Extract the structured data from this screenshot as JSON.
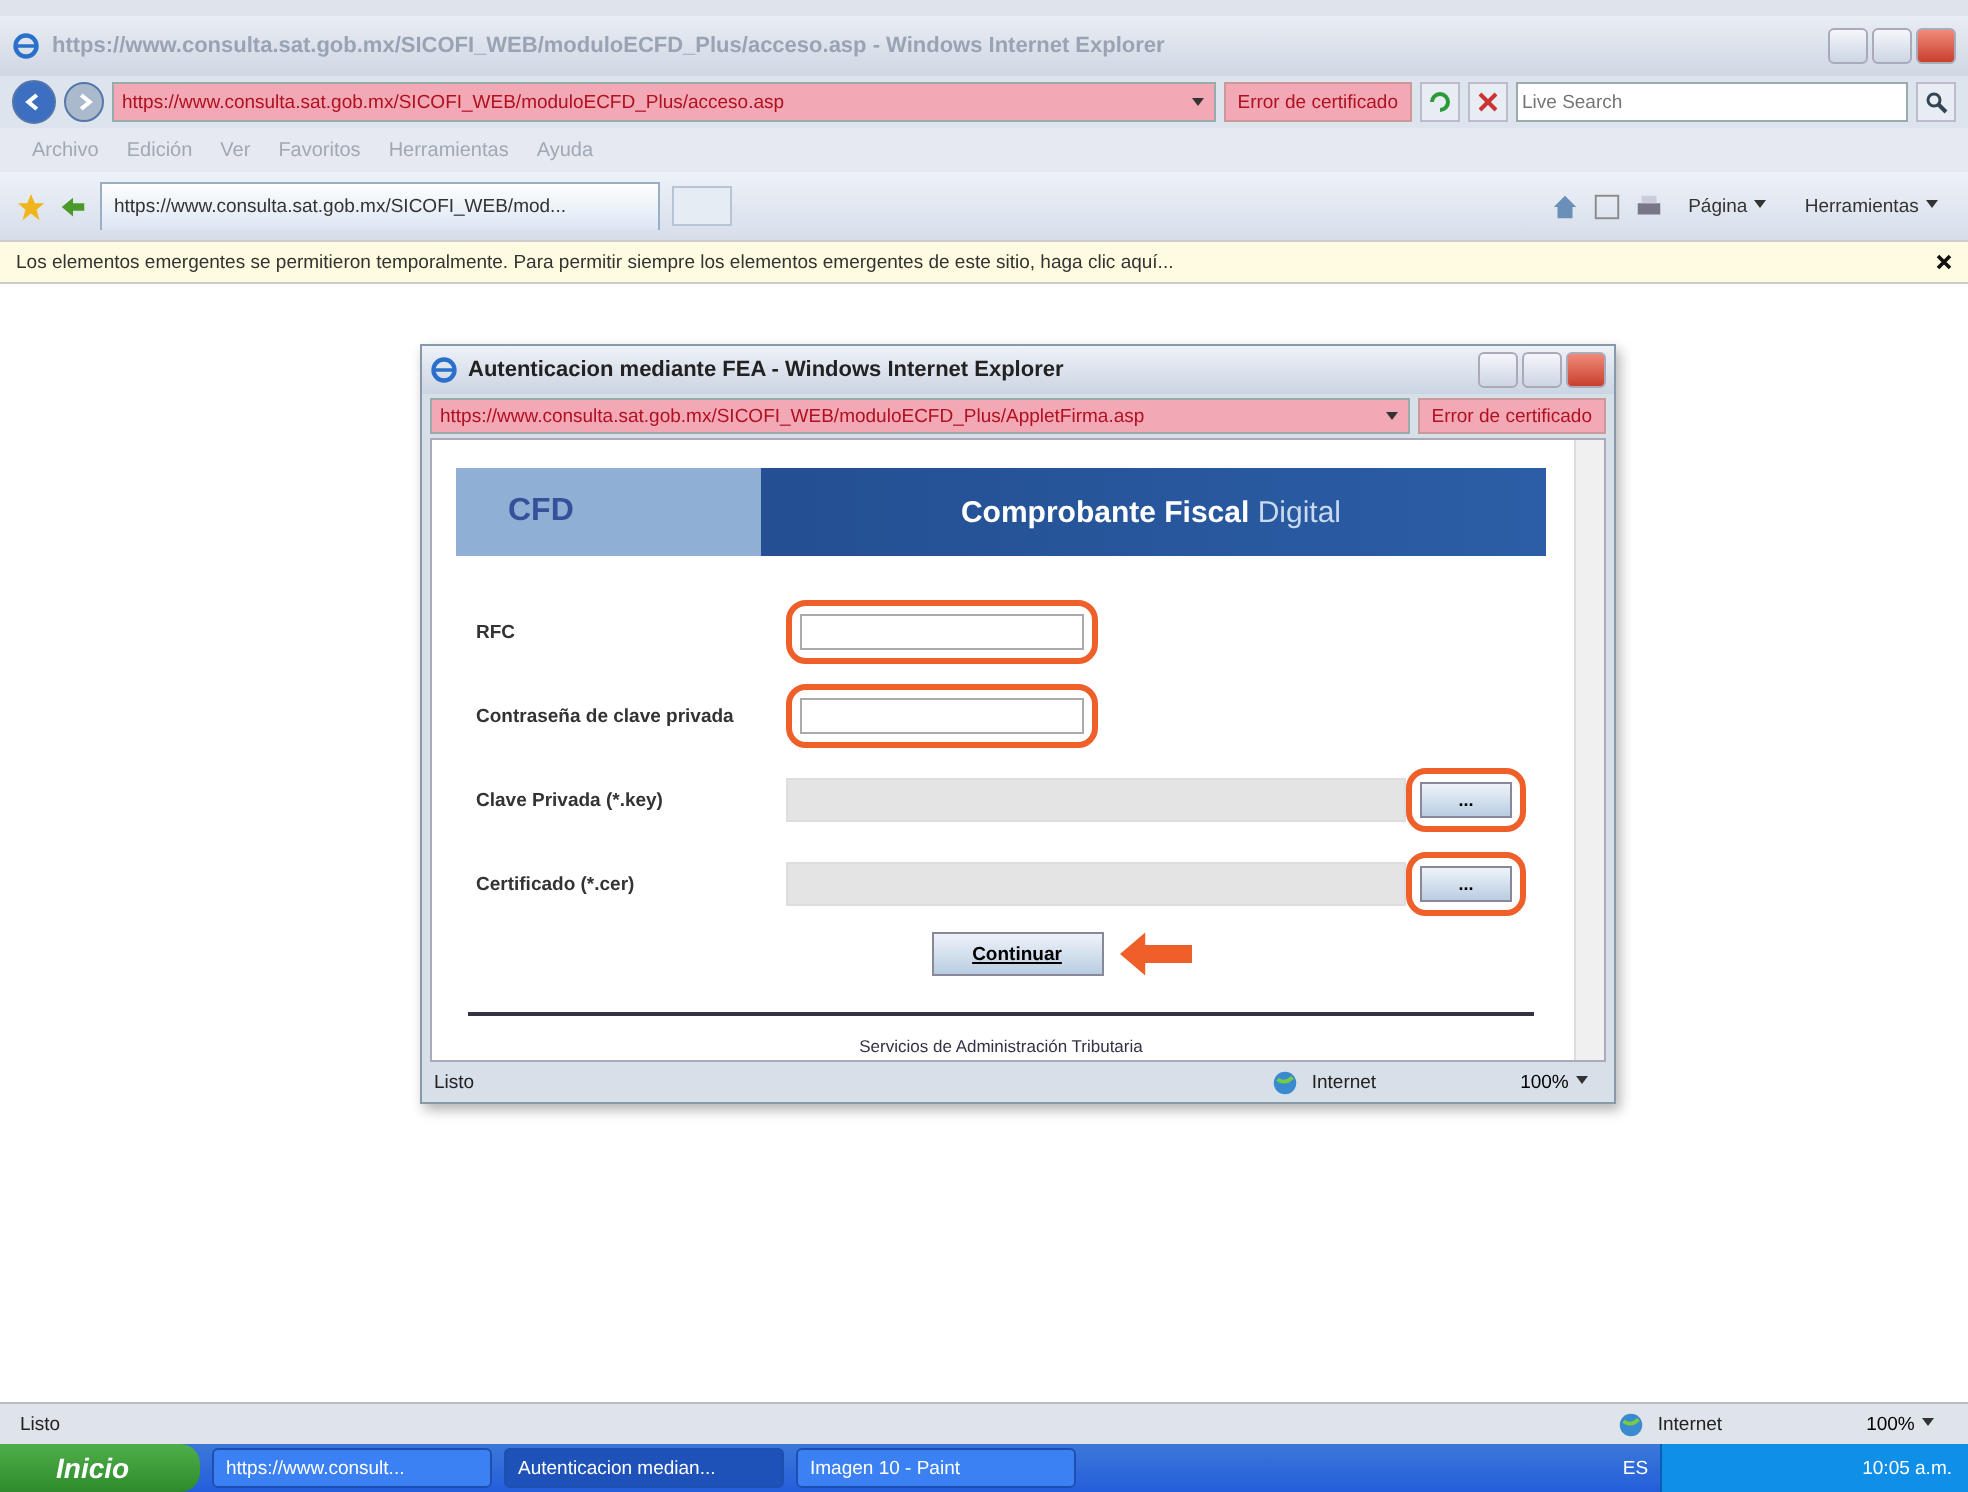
{
  "browser": {
    "title": "https://www.consulta.sat.gob.mx/SICOFI_WEB/moduloECFD_Plus/acceso.asp - Windows Internet Explorer",
    "address": "https://www.consulta.sat.gob.mx/SICOFI_WEB/moduloECFD_Plus/acceso.asp",
    "cert_error": "Error de certificado",
    "search_placeholder": "Live Search",
    "menu": [
      "Archivo",
      "Edición",
      "Ver",
      "Favoritos",
      "Herramientas",
      "Ayuda"
    ],
    "tabs": [
      {
        "label": "https://www.consulta.sat.gob.mx/SICOFI_WEB/mod...",
        "selected": true
      }
    ],
    "toolbar": [
      "Página",
      "Herramientas"
    ],
    "info_bar": "Los elementos emergentes se permitieron temporalmente. Para permitir siempre los elementos emergentes de este sitio, haga clic aquí...",
    "status": "Listo",
    "zone": "Internet",
    "zoom": "100%"
  },
  "popup": {
    "title": "Autenticacion mediante FEA - Windows Internet Explorer",
    "address": "https://www.consulta.sat.gob.mx/SICOFI_WEB/moduloECFD_Plus/AppletFirma.asp",
    "cert_error": "Error de certificado",
    "banner": {
      "logo": "CFD",
      "title": "Comprobante Fiscal",
      "title_light": "Digital"
    },
    "fields": [
      {
        "label": "RFC",
        "kind": "text",
        "highlighted": true
      },
      {
        "label": "Contraseña de clave privada",
        "kind": "text",
        "highlighted": true
      },
      {
        "label": "Clave Privada (*.key)",
        "kind": "file",
        "button": "...",
        "highlighted": true
      },
      {
        "label": "Certificado (*.cer)",
        "kind": "file",
        "button": "...",
        "highlighted": true
      }
    ],
    "button": "Continuar",
    "footer": "Servicios de Administración Tributaria",
    "status": "Listo",
    "zone": "Internet",
    "zoom": "100%"
  },
  "taskbar": {
    "start": "Inicio",
    "items": [
      {
        "label": "https://www.consult...",
        "selected": false
      },
      {
        "label": "Autenticacion median...",
        "selected": true
      },
      {
        "label": "Imagen 10 - Paint",
        "selected": false
      }
    ],
    "lang": "ES",
    "clock": "10:05 a.m."
  }
}
